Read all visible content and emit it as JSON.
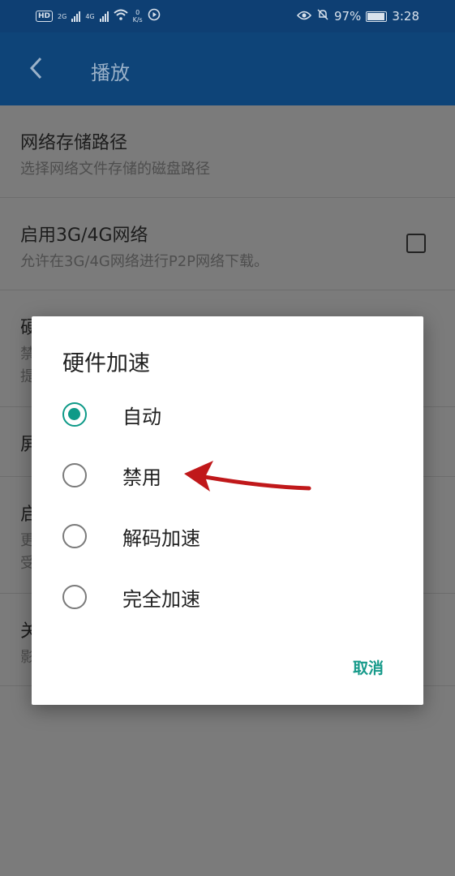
{
  "status_bar": {
    "hd_label": "HD",
    "hd_sub": "2",
    "net1": "2G",
    "net2": "4G",
    "speed_value": "0",
    "speed_unit": "K/s",
    "battery": "97%",
    "time": "3:28"
  },
  "app_bar": {
    "title": "播放",
    "back_icon": "chevron-left-icon"
  },
  "settings": {
    "items": [
      {
        "title": "网络存储路径",
        "subtitle": "选择网络文件存储的磁盘路径"
      },
      {
        "title": "启用3G/4G网络",
        "subtitle": "允许在3G/4G网络进行P2P网络下载。",
        "checked": false
      },
      {
        "title": "硬",
        "subtitle_line1": "禁",
        "subtitle_line2": "提"
      },
      {
        "title": "屏"
      },
      {
        "title": "启",
        "subtitle_line1": "更",
        "subtitle_line2": "受"
      },
      {
        "title": "关",
        "subtitle": "影"
      }
    ]
  },
  "dialog": {
    "title": "硬件加速",
    "options": [
      {
        "label": "自动",
        "selected": true
      },
      {
        "label": "禁用",
        "selected": false
      },
      {
        "label": "解码加速",
        "selected": false
      },
      {
        "label": "完全加速",
        "selected": false
      }
    ],
    "cancel": "取消"
  },
  "colors": {
    "app_bar": "#0e4478",
    "status_bar": "#0e3f73",
    "accent": "#0e9a88",
    "annotation_arrow": "#c0181a"
  }
}
